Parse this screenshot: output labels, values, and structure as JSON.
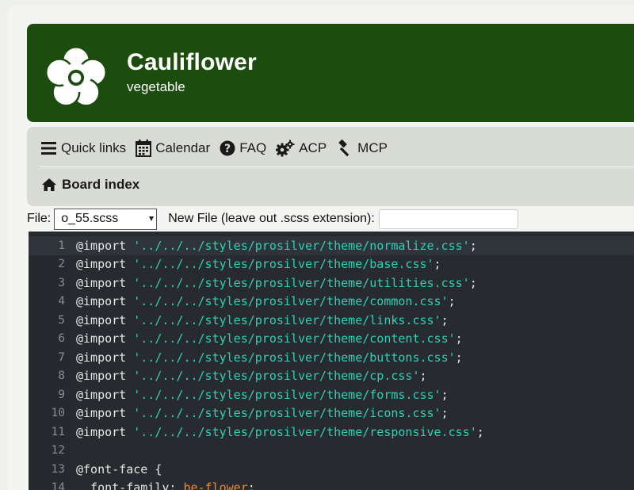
{
  "site": {
    "title": "Cauliflower",
    "description": "vegetable",
    "logo_icon": "flower-icon"
  },
  "nav": {
    "items": [
      {
        "label": "Quick links",
        "icon": "bars-icon"
      },
      {
        "label": "Calendar",
        "icon": "calendar-icon"
      },
      {
        "label": "FAQ",
        "icon": "question-circle-icon"
      },
      {
        "label": "ACP",
        "icon": "cogs-icon"
      },
      {
        "label": "MCP",
        "icon": "gavel-icon"
      }
    ],
    "board_index": "Board index"
  },
  "filebar": {
    "file_label": "File:",
    "file_selected": "o_55.scss",
    "new_file_label": "New File (leave out .scss extension):",
    "new_file_value": ""
  },
  "editor": {
    "lines": [
      {
        "num": "1",
        "kw": "@import",
        "str": "'../../../styles/prosilver/theme/normalize.css'",
        "end": ";"
      },
      {
        "num": "2",
        "kw": "@import",
        "str": "'../../../styles/prosilver/theme/base.css'",
        "end": ";"
      },
      {
        "num": "3",
        "kw": "@import",
        "str": "'../../../styles/prosilver/theme/utilities.css'",
        "end": ";"
      },
      {
        "num": "4",
        "kw": "@import",
        "str": "'../../../styles/prosilver/theme/common.css'",
        "end": ";"
      },
      {
        "num": "5",
        "kw": "@import",
        "str": "'../../../styles/prosilver/theme/links.css'",
        "end": ";"
      },
      {
        "num": "6",
        "kw": "@import",
        "str": "'../../../styles/prosilver/theme/content.css'",
        "end": ";"
      },
      {
        "num": "7",
        "kw": "@import",
        "str": "'../../../styles/prosilver/theme/buttons.css'",
        "end": ";"
      },
      {
        "num": "8",
        "kw": "@import",
        "str": "'../../../styles/prosilver/theme/cp.css'",
        "end": ";"
      },
      {
        "num": "9",
        "kw": "@import",
        "str": "'../../../styles/prosilver/theme/forms.css'",
        "end": ";"
      },
      {
        "num": "10",
        "kw": "@import",
        "str": "'../../../styles/prosilver/theme/icons.css'",
        "end": ";"
      },
      {
        "num": "11",
        "kw": "@import",
        "str": "'../../../styles/prosilver/theme/responsive.css'",
        "end": ";"
      },
      {
        "num": "12",
        "kw": "",
        "str": "",
        "end": ""
      },
      {
        "num": "13",
        "kw": "@font-face {",
        "str": "",
        "end": ""
      },
      {
        "num": "14",
        "kw": "  font-family: ",
        "str": "",
        "val": "be-flower",
        "end": ";"
      }
    ]
  },
  "colors": {
    "header_bg": "#1d4c0f",
    "editor_bg": "#272a2e",
    "string": "#2bd1b7"
  }
}
